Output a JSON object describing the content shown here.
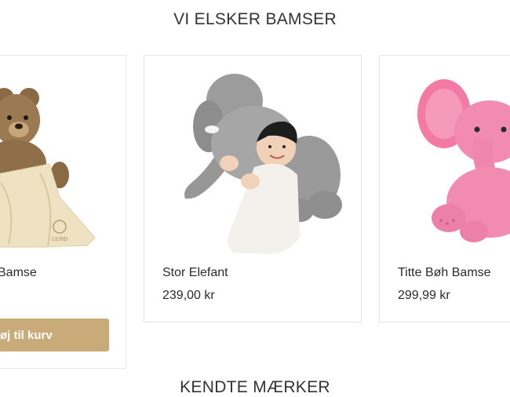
{
  "section": {
    "title": "VI ELSKER BAMSER"
  },
  "products": [
    {
      "name": "Bamse",
      "price": "",
      "cart_label": "føj til kurv"
    },
    {
      "name": "Stor Elefant",
      "price": "239,00 kr"
    },
    {
      "name": "Titte Bøh Bamse",
      "price": "299,99 kr"
    }
  ],
  "next_section": {
    "title": "KENDTE MÆRKER"
  },
  "colors": {
    "accent": "#c9ab79",
    "border": "#e6e6e6",
    "text": "#2b2b2b"
  }
}
